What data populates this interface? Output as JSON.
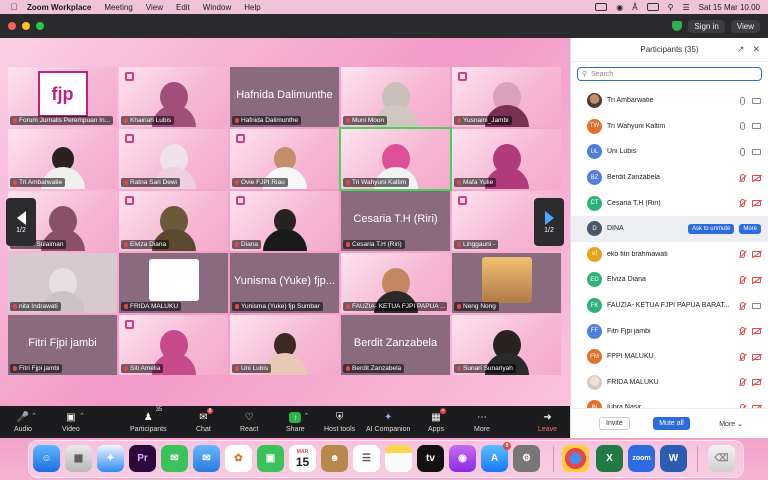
{
  "menubar": {
    "app": "Zoom Workplace",
    "items": [
      "Meeting",
      "View",
      "Edit",
      "Window",
      "Help"
    ],
    "datetime": "Sat 15 Mar  10.00"
  },
  "titlebar": {
    "signin": "Sign in",
    "view": "View"
  },
  "gallery": {
    "page_left": "1/2",
    "page_right": "1/2",
    "tiles": [
      {
        "name": "Forum Jurnalis Perempuan In..."
      },
      {
        "name": "Khairiah Lubis"
      },
      {
        "name": "Hafnida Dalimunthe",
        "big": "Hafnida Dalimunthe"
      },
      {
        "name": "Muni Moon"
      },
      {
        "name": "Yusnaini_Jambi"
      },
      {
        "name": "Tri Ambarwatie"
      },
      {
        "name": "Ratna Sari Dewi"
      },
      {
        "name": "Ovie FJPI Riau"
      },
      {
        "name": "Tri Wahyuni Kaltim"
      },
      {
        "name": "Mafa Yulie"
      },
      {
        "name": "Nurul Sulaiman"
      },
      {
        "name": "Elviza Diana"
      },
      {
        "name": "Diana"
      },
      {
        "name": "Cesaria T.H (Riri)",
        "big": "Cesaria T.H (Riri)"
      },
      {
        "name": "Linggauni -"
      },
      {
        "name": "nita Indrawati"
      },
      {
        "name": "FRIDA MALUKU"
      },
      {
        "name": "Yunisma (Yuke) fjp Sumbar",
        "big": "Yunisma (Yuke) fjp..."
      },
      {
        "name": "FAUZIA- KETUA FJPI PAPUA ..."
      },
      {
        "name": "Neng Nong"
      },
      {
        "name": "Fitri Fjpi jambi",
        "big": "Fitri Fjpi jambi"
      },
      {
        "name": "Siti Amelia"
      },
      {
        "name": "Uni Lubis"
      },
      {
        "name": "Berdit Zanzabela",
        "big": "Berdit Zanzabela"
      },
      {
        "name": "Sunari Sunariyah"
      }
    ]
  },
  "toolbar": {
    "audio": "Audio",
    "video": "Video",
    "participants": "Participants",
    "participants_count": "35",
    "chat": "Chat",
    "chat_badge": "8",
    "react": "React",
    "share": "Share",
    "host_tools": "Host tools",
    "ai_companion": "AI Companion",
    "apps": "Apps",
    "more": "More",
    "leave": "Leave"
  },
  "participants_panel": {
    "title": "Participants (35)",
    "search_placeholder": "Search",
    "ask_to_unmute": "Ask to unmute",
    "more_label": "More",
    "rows": [
      {
        "initials": "",
        "name": "Tri Ambarwatie",
        "color": "photo"
      },
      {
        "initials": "TW",
        "name": "Tri Wahyuni Kaltim",
        "color": "#e0702a"
      },
      {
        "initials": "UL",
        "name": "Uni Lubis",
        "color": "#4f7ee0"
      },
      {
        "initials": "BZ",
        "name": "Berdit Zanzabela",
        "color": "#4f7ee0"
      },
      {
        "initials": "CT",
        "name": "Cesaria T.H (Riri)",
        "color": "#2fb27a"
      },
      {
        "initials": "D",
        "name": "DINA",
        "color": "#4a5568"
      },
      {
        "initials": "ef",
        "name": "eko fitri brahmawati",
        "color": "#e8a21a"
      },
      {
        "initials": "ED",
        "name": "Elviza Diana",
        "color": "#2fb27a"
      },
      {
        "initials": "FK",
        "name": "FAUZIA- KETUA FJPI PAPUA BARAT...",
        "color": "#2fb27a"
      },
      {
        "initials": "FF",
        "name": "Fitri Fjpi jambi",
        "color": "#4f7ee0"
      },
      {
        "initials": "FM",
        "name": "FPPI MALUKU",
        "color": "#e0702a"
      },
      {
        "initials": "",
        "name": "FRIDA MALUKU",
        "color": "photo2"
      },
      {
        "initials": "IN",
        "name": "Iubra Nasir",
        "color": "#e0702a"
      }
    ],
    "invite": "Invite",
    "mute_all": "Mute all",
    "footer_more": "More"
  },
  "dock": {
    "calendar_month": "MAR",
    "calendar_day": "15",
    "appstore_badge": "8",
    "zoom_label": "zoom"
  }
}
